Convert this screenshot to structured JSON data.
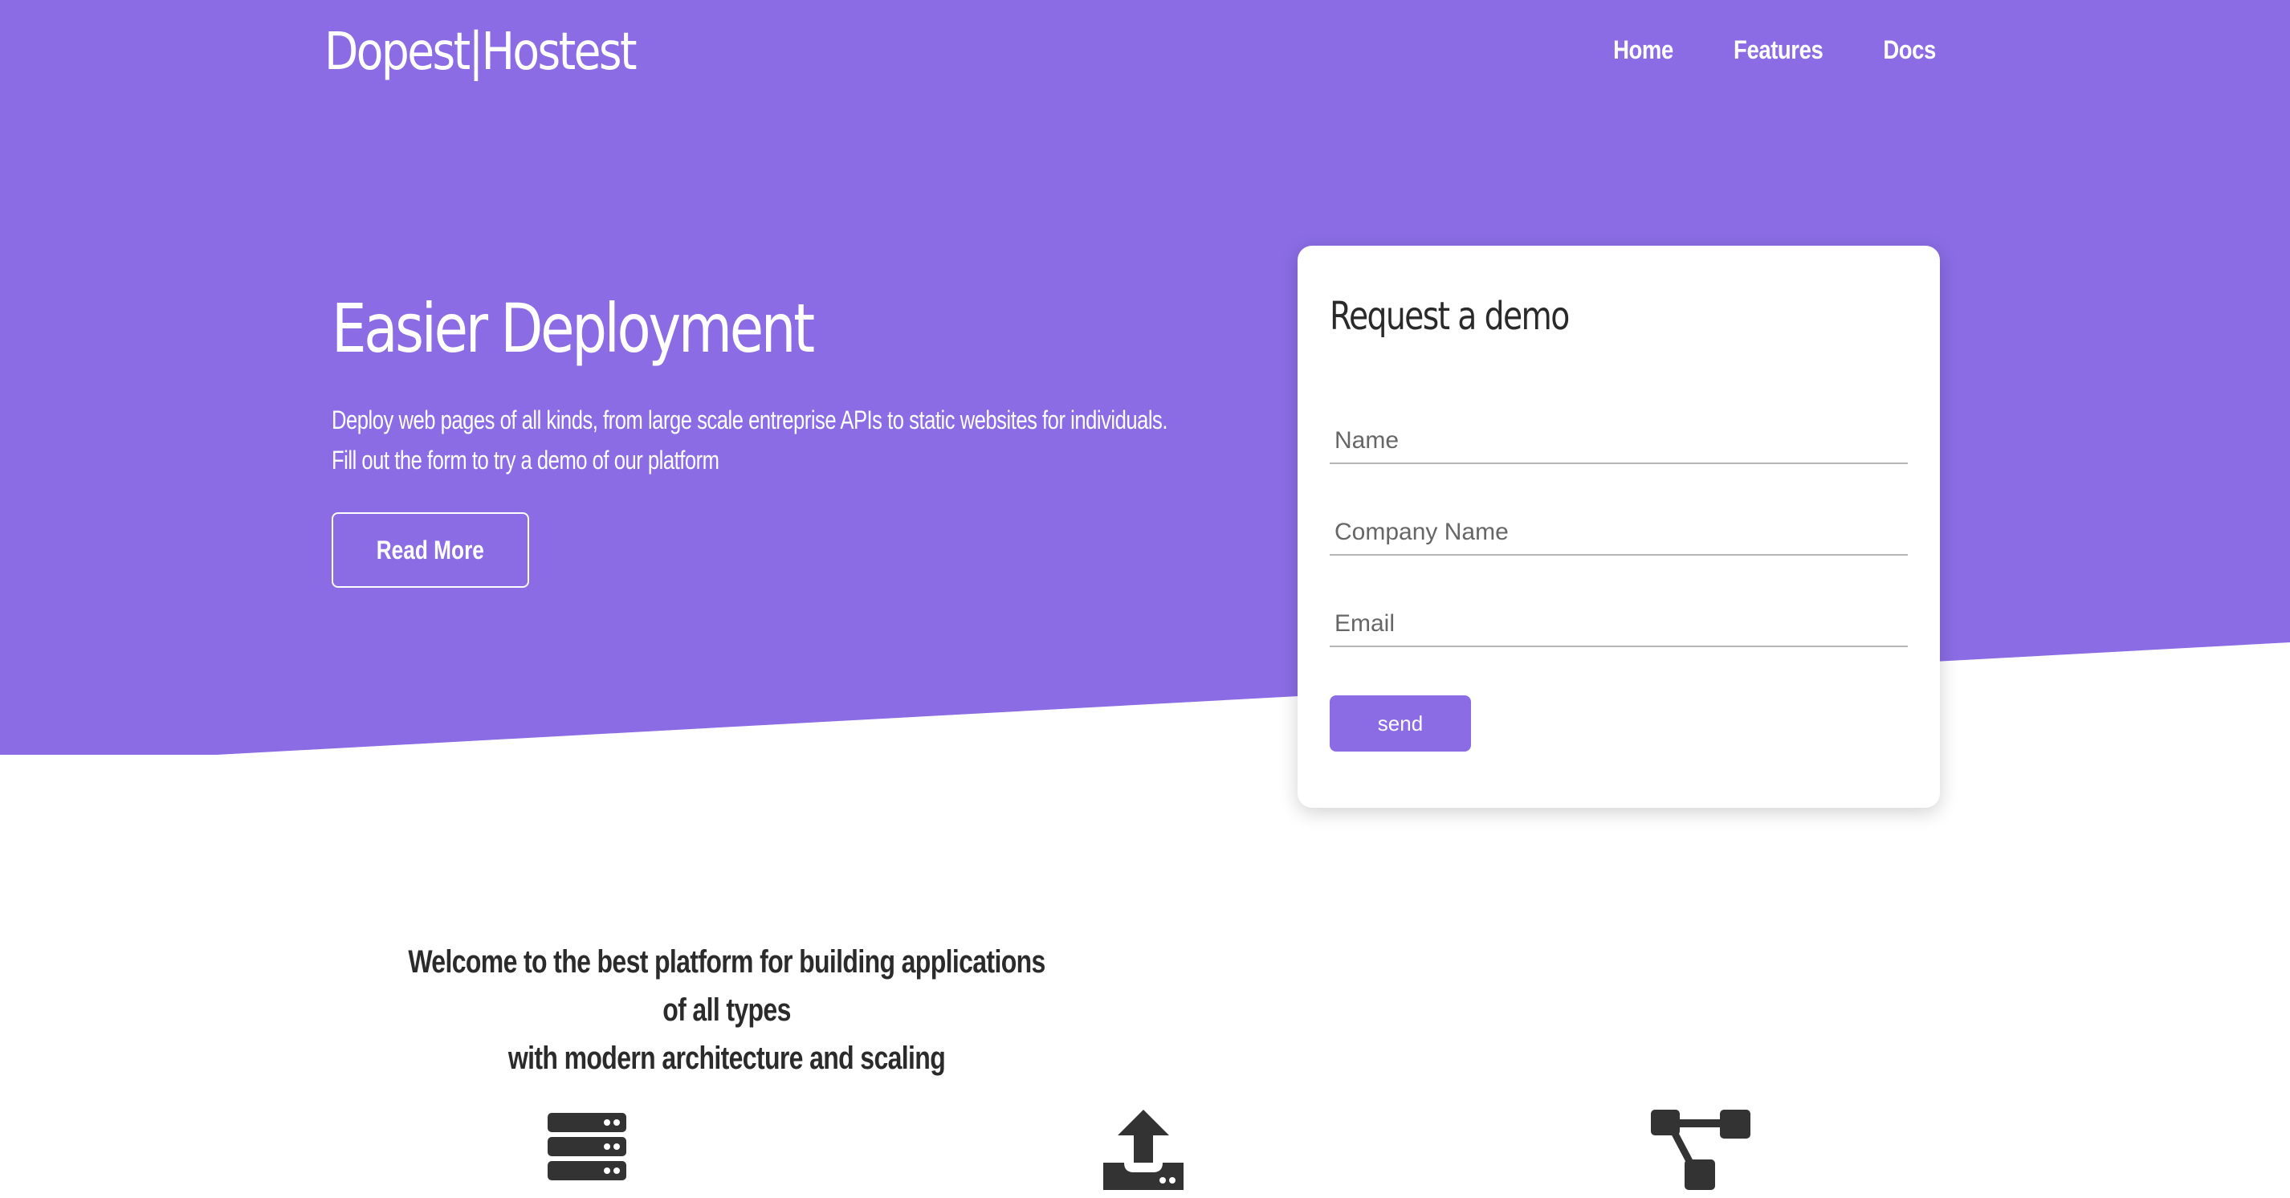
{
  "header": {
    "brand": "Dopest|Hostest",
    "nav": [
      {
        "label": "Home"
      },
      {
        "label": "Features"
      },
      {
        "label": "Docs"
      }
    ]
  },
  "hero": {
    "title": "Easier Deployment",
    "description_line1": "Deploy web pages of all kinds, from large scale entreprise APIs to static websites for individuals.",
    "description_line2": "Fill out the form to try a demo of our platform",
    "read_more_label": "Read More"
  },
  "demo_form": {
    "title": "Request a demo",
    "name_placeholder": "Name",
    "company_placeholder": "Company Name",
    "email_placeholder": "Email",
    "send_label": "send"
  },
  "welcome": {
    "line1": "Welcome to the best platform for building applications of all types",
    "line2": "with modern architecture and scaling"
  },
  "features": {
    "icons": [
      "server-icon",
      "upload-icon",
      "sitemap-icon"
    ]
  },
  "colors": {
    "accent": "#8b6ce5",
    "text_dark": "#2b2b2b",
    "icon": "#333333"
  }
}
